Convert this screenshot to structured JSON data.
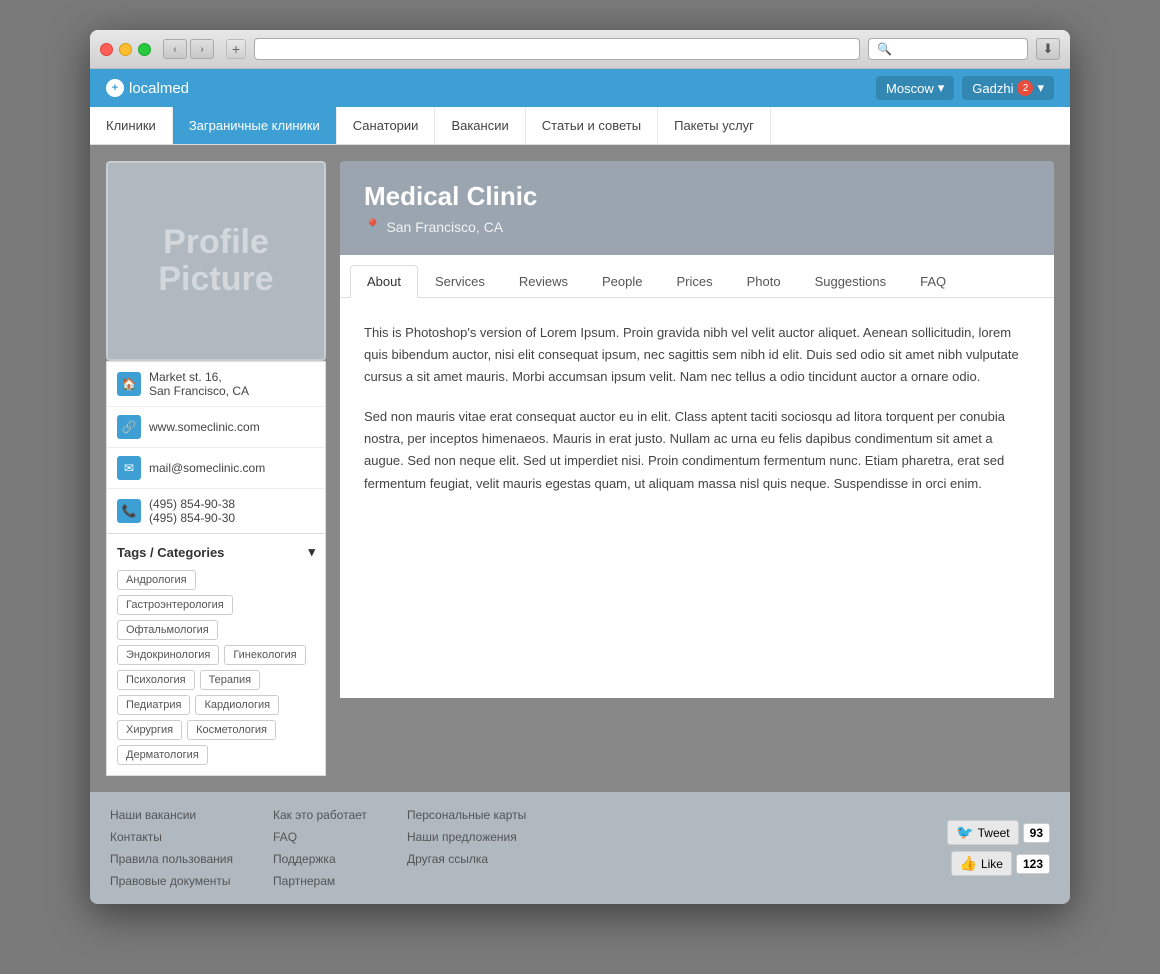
{
  "browser": {
    "address": "",
    "search_placeholder": "Q-",
    "reload_symbol": "↺"
  },
  "header": {
    "logo": "localmed",
    "logo_icon": "+",
    "city": "Moscow",
    "user": "Gadzhi",
    "notification_count": "2"
  },
  "nav": {
    "items": [
      {
        "label": "Клиники",
        "active": false
      },
      {
        "label": "Заграничные клиники",
        "active": true
      },
      {
        "label": "Санатории",
        "active": false
      },
      {
        "label": "Вакансии",
        "active": false
      },
      {
        "label": "Статьи и советы",
        "active": false
      },
      {
        "label": "Пакеты услуг",
        "active": false
      }
    ]
  },
  "clinic": {
    "name": "Medical Clinic",
    "location": "San Francisco, CA",
    "profile_picture_text": "Profile\nPicture"
  },
  "contact": {
    "address_line1": "Market st. 16,",
    "address_line2": "San Francisco, CA",
    "website": "www.someclinic.com",
    "email": "mail@someclinic.com",
    "phone1": "(495) 854-90-38",
    "phone2": "(495) 854-90-30"
  },
  "tags": {
    "header": "Tags / Categories",
    "items": [
      "Андрология",
      "Гастроэнтерология",
      "Офтальмология",
      "Эндокринология",
      "Гинекология",
      "Психология",
      "Терапия",
      "Педиатрия",
      "Кардиология",
      "Хирургия",
      "Косметология",
      "Дерматология"
    ]
  },
  "tabs": [
    {
      "label": "About",
      "active": true
    },
    {
      "label": "Services",
      "active": false
    },
    {
      "label": "Reviews",
      "active": false
    },
    {
      "label": "People",
      "active": false
    },
    {
      "label": "Prices",
      "active": false
    },
    {
      "label": "Photo",
      "active": false
    },
    {
      "label": "Suggestions",
      "active": false
    },
    {
      "label": "FAQ",
      "active": false
    }
  ],
  "about": {
    "paragraph1": "This is Photoshop's version  of Lorem Ipsum. Proin gravida nibh vel velit auctor aliquet. Aenean sollicitudin, lorem quis bibendum auctor, nisi elit consequat ipsum, nec sagittis sem nibh id elit. Duis sed odio sit amet nibh vulputate cursus a sit amet mauris. Morbi accumsan ipsum velit. Nam nec tellus a odio tincidunt auctor a ornare odio.",
    "paragraph2": "Sed non  mauris vitae erat consequat auctor eu in elit. Class aptent taciti sociosqu ad litora torquent per conubia nostra, per inceptos himenaeos. Mauris in erat justo. Nullam ac urna eu felis dapibus condimentum sit amet a augue. Sed non neque elit. Sed ut imperdiet nisi. Proin condimentum fermentum nunc. Etiam pharetra, erat sed fermentum feugiat, velit mauris egestas quam, ut aliquam massa nisl quis neque. Suspendisse in orci enim."
  },
  "footer": {
    "col1": [
      "Наши вакансии",
      "Контакты",
      "Правила пользования",
      "Правовые документы"
    ],
    "col2": [
      "Как это работает",
      "FAQ",
      "Поддержка",
      "Партнерам"
    ],
    "col3": [
      "Персональные карты",
      "Наши предложения",
      "Другая ссылка"
    ]
  },
  "social": {
    "tweet_label": "Tweet",
    "tweet_count": "93",
    "like_label": "Like",
    "like_count": "123"
  }
}
